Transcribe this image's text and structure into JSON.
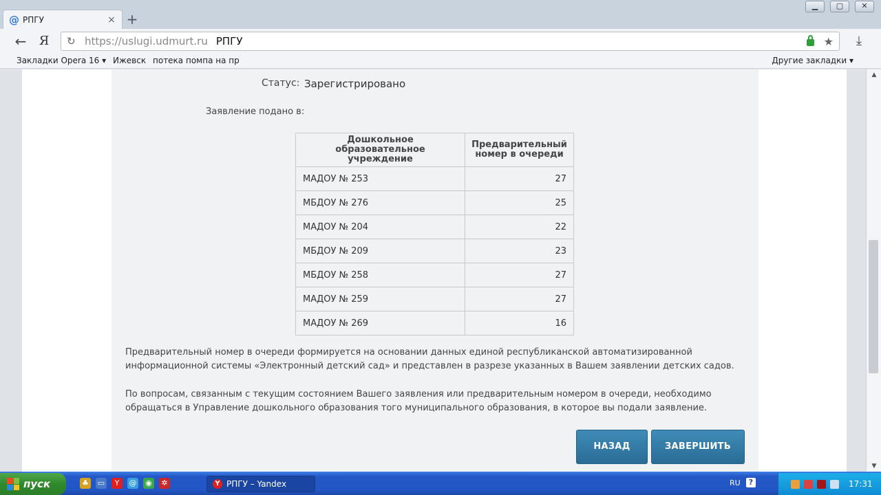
{
  "browser": {
    "tab_title": "РПГУ",
    "tab_icon": "@",
    "new_tab": "+",
    "tab_close": "×",
    "url_host": "https://uslugi.udmurt.ru",
    "url_title": "РПГУ",
    "nav_ya": "Я",
    "bookmarks": [
      "Закладки Opera 16",
      "Ижевск",
      "потека помпа на пр"
    ],
    "other_bookmarks": "Другие закладки"
  },
  "page": {
    "status_label": "Статус:",
    "status_value": "Зарегистрировано",
    "filed_label": "Заявление подано в:",
    "table": {
      "headers": [
        "Дошкольное образовательное учреждение",
        "Предварительный номер в очереди"
      ],
      "rows": [
        [
          "МАДОУ № 253",
          "27"
        ],
        [
          "МБДОУ № 276",
          "25"
        ],
        [
          "МАДОУ № 204",
          "22"
        ],
        [
          "МБДОУ № 209",
          "23"
        ],
        [
          "МБДОУ № 258",
          "27"
        ],
        [
          "МАДОУ № 259",
          "27"
        ],
        [
          "МАДОУ № 269",
          "16"
        ]
      ]
    },
    "note_1": "Предварительный номер в очереди формируется на основании данных единой республиканской автоматизированной информационной системы «Электронный детский сад» и представлен в разрезе указанных в Вашем заявлении детских садов.",
    "note_2": "По вопросам, связанным с текущим состоянием Вашего заявления или предварительным номером в очереди, необходимо обращаться в Управление дошкольного образования того муниципального образования, в которое вы подали заявление.",
    "back_button": "НАЗАД",
    "finish_button": "ЗАВЕРШИТЬ"
  },
  "taskbar": {
    "start_label": "пуск",
    "task_title": "РПГУ – Yandex",
    "language": "RU",
    "clock": "17:31"
  },
  "colors": {
    "button": "#2f78a6",
    "content_bg": "#f0f2f4",
    "taskbar": "#2458c8"
  }
}
